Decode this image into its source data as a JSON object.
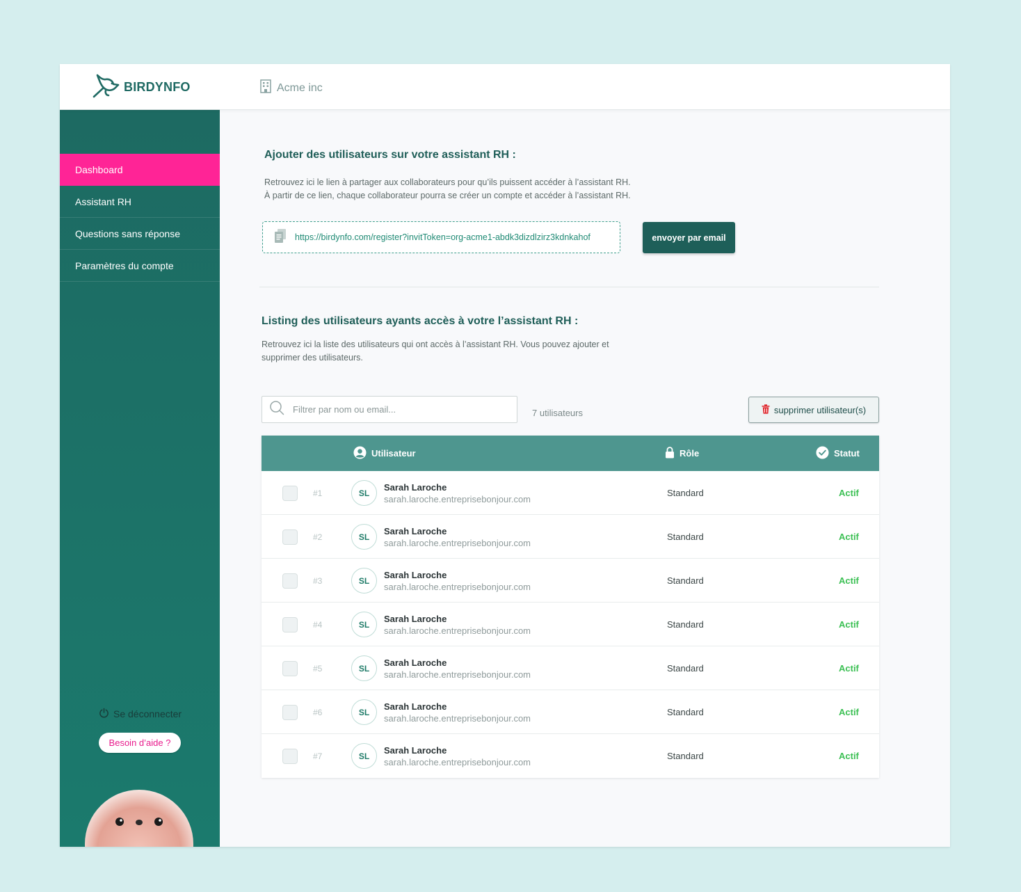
{
  "brand": {
    "name": "BIRDYNFO"
  },
  "org": {
    "name": "Acme inc"
  },
  "sidebar": {
    "items": [
      {
        "label": "Dashboard",
        "active": true
      },
      {
        "label": "Assistant RH",
        "active": false
      },
      {
        "label": "Questions sans réponse",
        "active": false
      },
      {
        "label": "Paramètres du compte",
        "active": false
      }
    ],
    "logout_label": "Se déconnecter",
    "help_label": "Besoin d’aide ?"
  },
  "invite": {
    "title": "Ajouter des utilisateurs sur votre assistant RH :",
    "desc_line1": "Retrouvez ici le lien à partager aux collaborateurs pour qu’ils puissent accéder à l’assistant RH.",
    "desc_line2": "À partir de ce lien, chaque collaborateur pourra se créer un compte et accéder à l’assistant RH.",
    "link": "https://birdynfo.com/register?invitToken=org-acme1-abdk3dizdlzirz3kdnkahof",
    "email_button": "envoyer par email"
  },
  "listing": {
    "title": "Listing des utilisateurs ayants accès à votre l’assistant RH  :",
    "desc_line1": "Retrouvez ici la liste des utilisateurs qui ont accès à l’assistant RH. Vous pouvez ajouter et",
    "desc_line2": "supprimer des utilisateurs.",
    "search_placeholder": "Filtrer par nom ou email...",
    "count_label": "7 utilisateurs",
    "delete_button": "supprimer utilisateur(s)",
    "columns": {
      "user": "Utilisateur",
      "role": "Rôle",
      "status": "Statut"
    },
    "rows": [
      {
        "index": "#1",
        "initials": "SL",
        "name": "Sarah Laroche",
        "email": "sarah.laroche.entreprisebonjour.com",
        "role": "Standard",
        "status": "Actif"
      },
      {
        "index": "#2",
        "initials": "SL",
        "name": "Sarah Laroche",
        "email": "sarah.laroche.entreprisebonjour.com",
        "role": "Standard",
        "status": "Actif"
      },
      {
        "index": "#3",
        "initials": "SL",
        "name": "Sarah Laroche",
        "email": "sarah.laroche.entreprisebonjour.com",
        "role": "Standard",
        "status": "Actif"
      },
      {
        "index": "#4",
        "initials": "SL",
        "name": "Sarah Laroche",
        "email": "sarah.laroche.entreprisebonjour.com",
        "role": "Standard",
        "status": "Actif"
      },
      {
        "index": "#5",
        "initials": "SL",
        "name": "Sarah Laroche",
        "email": "sarah.laroche.entreprisebonjour.com",
        "role": "Standard",
        "status": "Actif"
      },
      {
        "index": "#6",
        "initials": "SL",
        "name": "Sarah Laroche",
        "email": "sarah.laroche.entreprisebonjour.com",
        "role": "Standard",
        "status": "Actif"
      },
      {
        "index": "#7",
        "initials": "SL",
        "name": "Sarah Laroche",
        "email": "sarah.laroche.entreprisebonjour.com",
        "role": "Standard",
        "status": "Actif"
      }
    ]
  },
  "colors": {
    "brand": "#1f6a63",
    "sidebar": "#1d6a62",
    "active_nav": "#ff2496",
    "table_header": "#4e968f",
    "status_active": "#3cc054"
  },
  "icons": [
    "bird-logo-icon",
    "building-icon",
    "power-icon",
    "copy-icon",
    "search-icon",
    "trash-icon",
    "user-circle-icon",
    "lock-icon",
    "check-circle-icon"
  ]
}
